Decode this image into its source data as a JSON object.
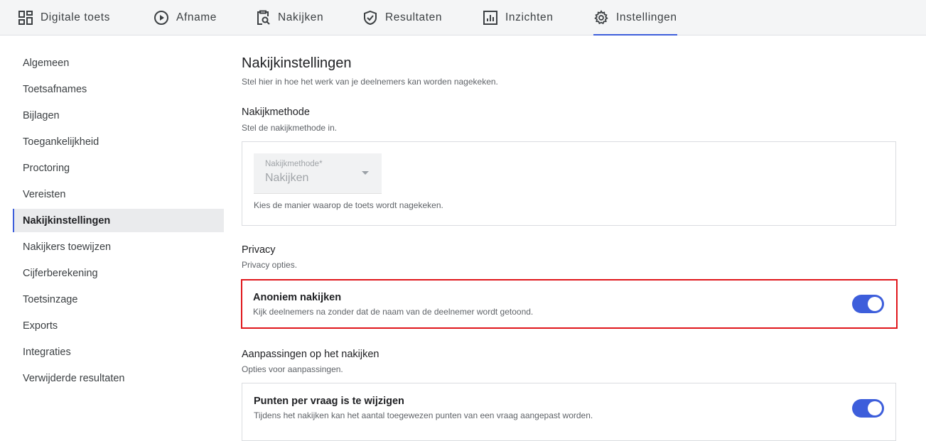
{
  "nav": {
    "tabs": [
      {
        "label": "Digitale toets",
        "icon": "dashboard-icon"
      },
      {
        "label": "Afname",
        "icon": "play-circle-icon"
      },
      {
        "label": "Nakijken",
        "icon": "clipboard-search-icon"
      },
      {
        "label": "Resultaten",
        "icon": "shield-check-icon"
      },
      {
        "label": "Inzichten",
        "icon": "bar-chart-icon"
      },
      {
        "label": "Instellingen",
        "icon": "gear-icon",
        "active": true
      }
    ],
    "accent_color": "#3d5edb"
  },
  "sidebar": {
    "items": [
      {
        "label": "Algemeen"
      },
      {
        "label": "Toetsafnames"
      },
      {
        "label": "Bijlagen"
      },
      {
        "label": "Toegankelijkheid"
      },
      {
        "label": "Proctoring"
      },
      {
        "label": "Vereisten"
      },
      {
        "label": "Nakijkinstellingen",
        "active": true
      },
      {
        "label": "Nakijkers toewijzen"
      },
      {
        "label": "Cijferberekening"
      },
      {
        "label": "Toetsinzage"
      },
      {
        "label": "Exports"
      },
      {
        "label": "Integraties"
      },
      {
        "label": "Verwijderde resultaten"
      }
    ]
  },
  "main": {
    "title": "Nakijkinstellingen",
    "subtitle": "Stel hier in hoe het werk van je deelnemers kan worden nagekeken.",
    "method": {
      "title": "Nakijkmethode",
      "subtitle": "Stel de nakijkmethode in.",
      "select_label": "Nakijkmethode*",
      "select_value": "Nakijken",
      "helper": "Kies de manier waarop de toets wordt nagekeken."
    },
    "privacy": {
      "title": "Privacy",
      "subtitle": "Privacy opties.",
      "option_title": "Anoniem nakijken",
      "option_desc": "Kijk deelnemers na zonder dat de naam van de deelnemer wordt getoond.",
      "enabled": true
    },
    "adjust": {
      "title": "Aanpassingen op het nakijken",
      "subtitle": "Opties voor aanpassingen.",
      "option_title": "Punten per vraag is te wijzigen",
      "option_desc": "Tijdens het nakijken kan het aantal toegewezen punten van een vraag aangepast worden.",
      "enabled": true
    },
    "highlight_color": "#e0161b"
  }
}
